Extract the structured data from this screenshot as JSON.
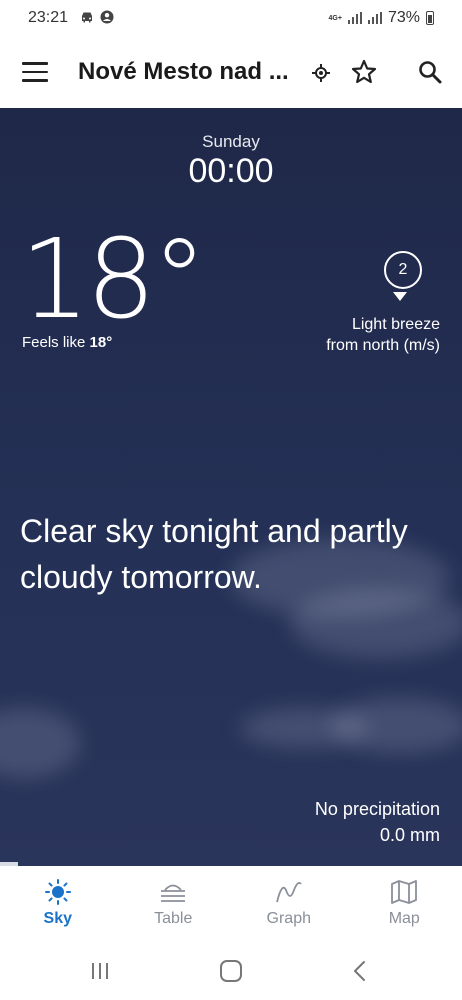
{
  "status_bar": {
    "time": "23:21",
    "network_label": "4G+",
    "battery": "73%"
  },
  "app_bar": {
    "title": "Nové Mesto nad ..."
  },
  "weather": {
    "day": "Sunday",
    "time": "00:00",
    "temperature": "18°",
    "feels_like_label": "Feels like",
    "feels_like_value": "18°",
    "wind_speed": "2",
    "wind_line1": "Light breeze",
    "wind_line2": "from north (m/s)",
    "forecast_text": "Clear sky tonight and partly cloudy tomorrow.",
    "precip_label": "No precipitation",
    "precip_value": "0.0 mm"
  },
  "bottom_nav": {
    "items": [
      {
        "label": "Sky",
        "icon": "sun-icon",
        "active": true
      },
      {
        "label": "Table",
        "icon": "table-icon",
        "active": false
      },
      {
        "label": "Graph",
        "icon": "graph-icon",
        "active": false
      },
      {
        "label": "Map",
        "icon": "map-icon",
        "active": false
      }
    ]
  },
  "colors": {
    "accent": "#1a73c8",
    "sky_background": "#243056",
    "inactive_nav": "#8a8f99"
  }
}
